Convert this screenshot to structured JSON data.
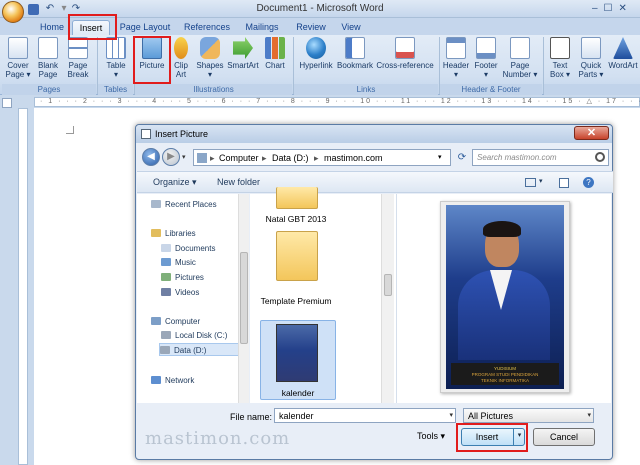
{
  "window": {
    "title": "Document1 - Microsoft Word"
  },
  "qat": {
    "save_icon": "save-icon",
    "undo_glyph": "↶",
    "redo_glyph": "↷",
    "more_glyph": "▾"
  },
  "tabs": [
    {
      "label": "Home"
    },
    {
      "label": "Insert",
      "active": true
    },
    {
      "label": "Page Layout"
    },
    {
      "label": "References"
    },
    {
      "label": "Mailings"
    },
    {
      "label": "Review"
    },
    {
      "label": "View"
    }
  ],
  "ribbon": {
    "groups": {
      "pages": "Pages",
      "tables": "Tables",
      "illustrations": "Illustrations",
      "links": "Links",
      "header_footer": "Header & Footer"
    },
    "buttons": {
      "cover_page": [
        "Cover",
        "Page ▾"
      ],
      "blank_page": [
        "Blank",
        "Page"
      ],
      "page_break": [
        "Page",
        "Break"
      ],
      "table": [
        "Table",
        "▾"
      ],
      "picture": [
        "Picture"
      ],
      "clip_art": [
        "Clip",
        "Art"
      ],
      "shapes": [
        "Shapes",
        "▾"
      ],
      "smartart": [
        "SmartArt"
      ],
      "chart": [
        "Chart"
      ],
      "hyperlink": [
        "Hyperlink"
      ],
      "bookmark": [
        "Bookmark"
      ],
      "cross_reference": [
        "Cross-reference"
      ],
      "header": [
        "Header",
        "▾"
      ],
      "footer": [
        "Footer",
        "▾"
      ],
      "page_number": [
        "Page",
        "Number ▾"
      ],
      "text_box": [
        "Text",
        "Box ▾"
      ],
      "quick_parts": [
        "Quick",
        "Parts ▾"
      ],
      "wordart": [
        "WordArt"
      ]
    }
  },
  "ruler": {
    "text": "· 1 · · · 2 · · · 3 · · · 4 · · · 5 · · · 6 · · · 7 · · · 8 · · · 9 · · · 10 · · · 11 · · · 12 · · · 13 · · · 14 · · · 15 · △ · 17 · · · 18"
  },
  "dialog": {
    "title": "Insert Picture",
    "close_glyph": "✕",
    "address": {
      "crumbs": [
        "Computer",
        "Data (D:)",
        "mastimon.com"
      ],
      "separator": "▸"
    },
    "search_placeholder": "Search mastimon.com",
    "toolbar": {
      "organize": "Organize ▾",
      "new_folder": "New folder"
    },
    "nav": [
      {
        "label": "Recent Places",
        "icon": "recent-places-icon",
        "color": "#a8b8cc"
      },
      {
        "label": "Libraries",
        "icon": "libraries-icon",
        "color": "#e2bd5d"
      },
      {
        "label": "Documents",
        "icon": "documents-icon",
        "color": "#c9d6e8"
      },
      {
        "label": "Music",
        "icon": "music-icon",
        "color": "#6d9bd1"
      },
      {
        "label": "Pictures",
        "icon": "pictures-icon",
        "color": "#7fb07a"
      },
      {
        "label": "Videos",
        "icon": "videos-icon",
        "color": "#6f7fa3"
      },
      {
        "label": "Computer",
        "icon": "computer-icon",
        "color": "#7c9ec7"
      },
      {
        "label": "Local Disk (C:)",
        "icon": "disk-icon",
        "color": "#9aa7b8"
      },
      {
        "label": "Data (D:)",
        "icon": "disk-icon",
        "color": "#9aa7b8",
        "selected": true
      },
      {
        "label": "Network",
        "icon": "network-icon",
        "color": "#5d8ed0"
      }
    ],
    "files": [
      {
        "name": "Natal GBT 2013"
      },
      {
        "name": "Template Premium"
      },
      {
        "name": "kalender",
        "selected": true
      }
    ],
    "preview_caption": [
      "YUDISIUM",
      "PROGRAM STUDI PENDIDIKAN",
      "TEKNIK INFORMATIKA"
    ],
    "file_name_label": "File name:",
    "file_name_value": "kalender",
    "file_type_value": "All Pictures",
    "tools_label": "Tools  ▾",
    "insert_label": "Insert",
    "cancel_label": "Cancel"
  },
  "watermark": "mastimon.com",
  "colors": {
    "highlight": "#e11c1c",
    "ribbon_text": "#15428b"
  }
}
